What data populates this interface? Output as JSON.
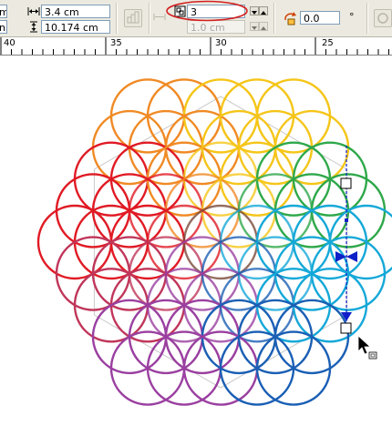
{
  "toolbar": {
    "width_partial": "m",
    "height_partial": "n",
    "object_width": "3.4 cm",
    "object_height": "10.174 cm",
    "blend_steps": "3",
    "blend_spacing": "1.0 cm",
    "rotation": "0.0",
    "rotation_unit": "°"
  },
  "ruler": {
    "labels": [
      "40",
      "35",
      "30",
      "25"
    ]
  },
  "colors": {
    "toolbar_bg": "#eceae0",
    "highlight_ellipse": "#d32020",
    "selection_blue": "#1020c8"
  }
}
